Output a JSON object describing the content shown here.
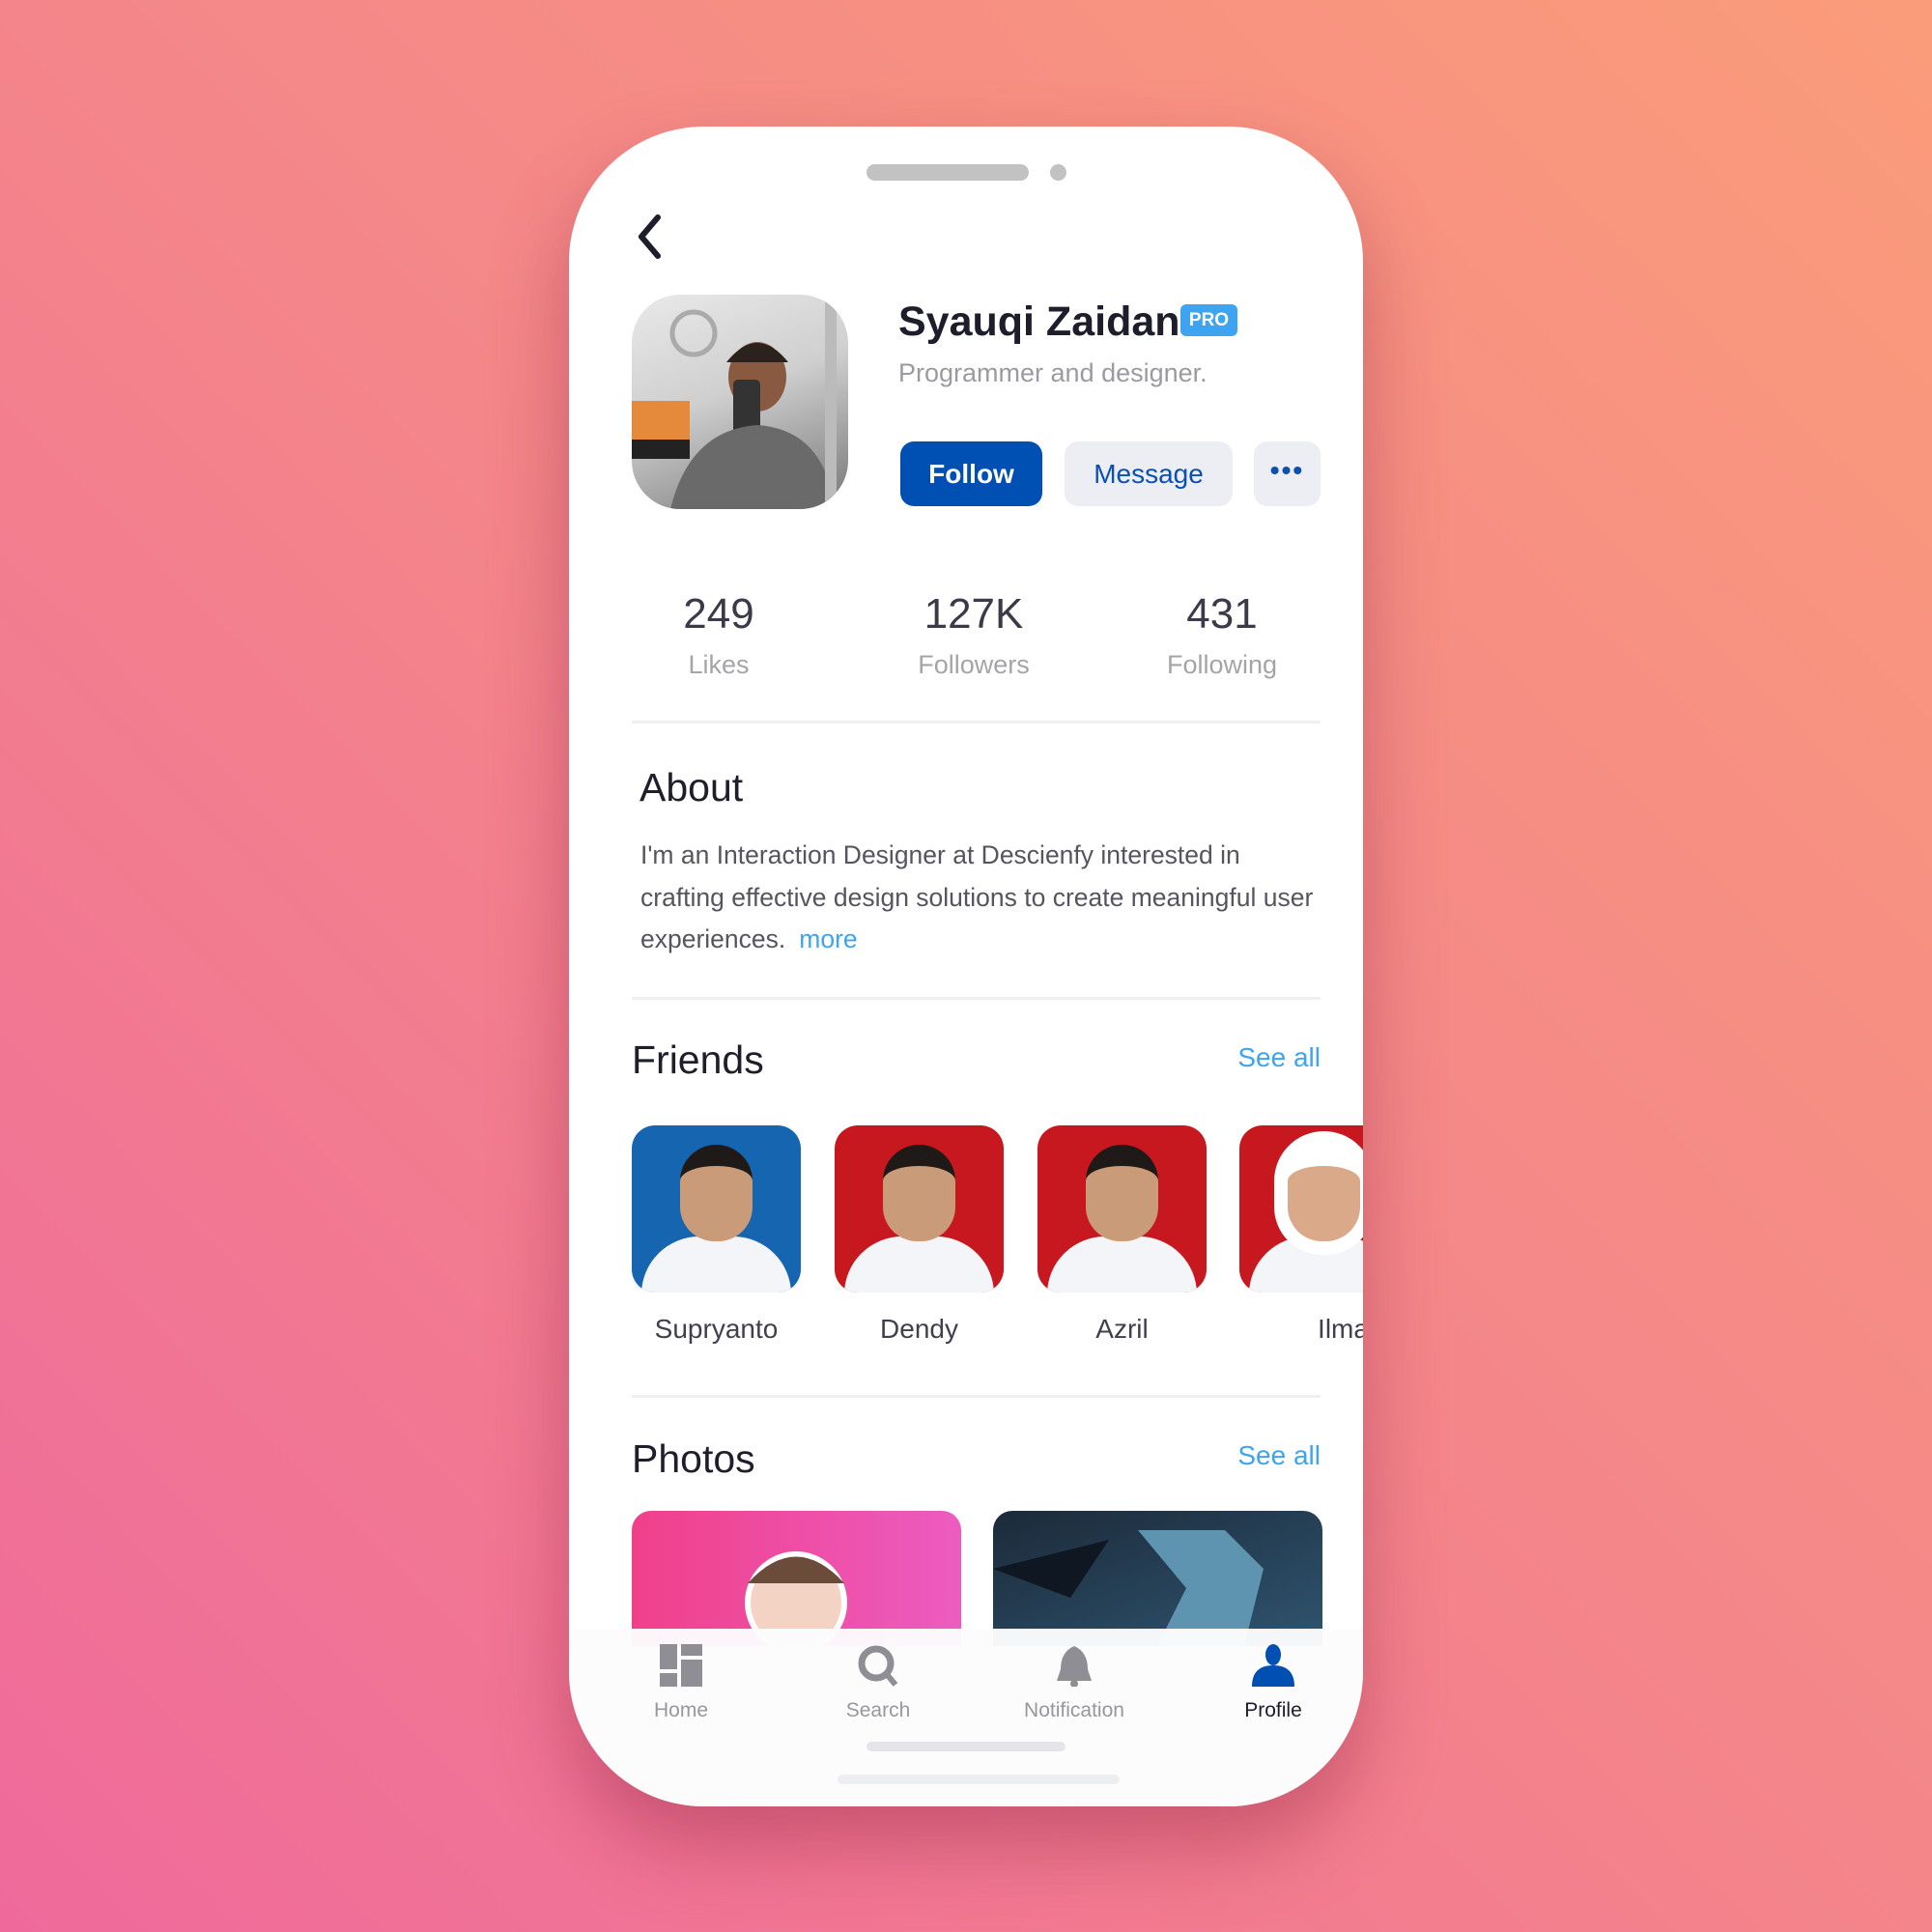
{
  "colors": {
    "accent": "#0050b3",
    "link": "#3ea4f0",
    "pro_badge": "#3ea4f0"
  },
  "profile": {
    "name": "Syauqi Zaidan",
    "badge": "PRO",
    "subtitle": "Programmer and designer.",
    "follow_label": "Follow",
    "message_label": "Message",
    "more_label": "•••"
  },
  "stats": [
    {
      "value": "249",
      "label": "Likes"
    },
    {
      "value": "127K",
      "label": "Followers"
    },
    {
      "value": "431",
      "label": "Following"
    }
  ],
  "about": {
    "title": "About",
    "text": "I'm an Interaction Designer at Descienfy interested in crafting effective design solutions to create meaningful user experiences.",
    "more": "more"
  },
  "friends": {
    "title": "Friends",
    "see_all": "See all",
    "items": [
      {
        "name": "Supryanto",
        "bg": "#1565b0"
      },
      {
        "name": "Dendy",
        "bg": "#c8181f"
      },
      {
        "name": "Azril",
        "bg": "#c8181f"
      },
      {
        "name": "Ilma",
        "bg": "#c8181f"
      }
    ]
  },
  "photos": {
    "title": "Photos",
    "see_all": "See all"
  },
  "nav": [
    {
      "label": "Home",
      "icon": "grid-icon"
    },
    {
      "label": "Search",
      "icon": "search-icon"
    },
    {
      "label": "Notification",
      "icon": "bell-icon"
    },
    {
      "label": "Profile",
      "icon": "user-icon",
      "active": true
    }
  ]
}
